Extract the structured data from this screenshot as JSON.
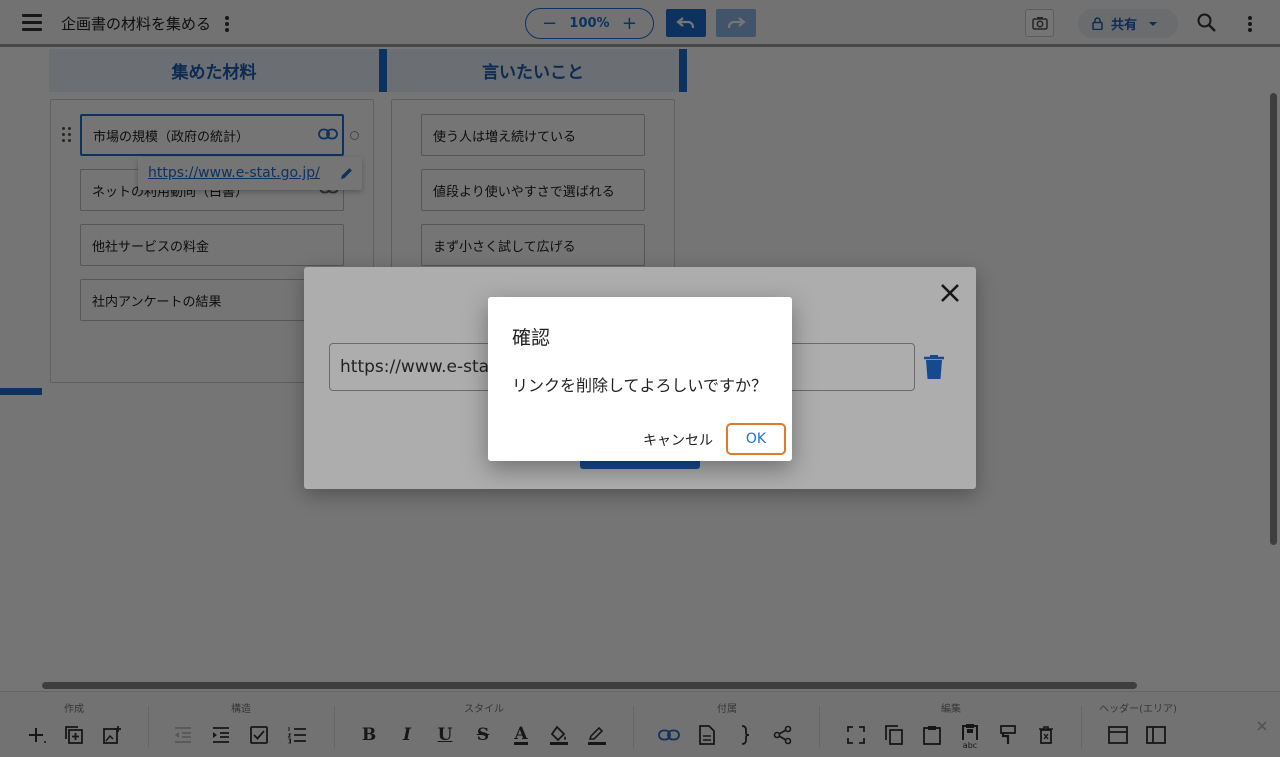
{
  "header": {
    "title": "企画書の材料を集める",
    "zoom_minus": "−",
    "zoom_value": "100%",
    "zoom_plus": "+",
    "share_label": "共有"
  },
  "areas": [
    {
      "title": "集めた材料",
      "cards": [
        "市場の規模（政府の統計）",
        "ネットの利用動向（白書）",
        "他社サービスの料金",
        "社内アンケートの結果"
      ]
    },
    {
      "title": "言いたいこと",
      "cards": [
        "使う人は増え続けている",
        "値段より使いやすさで選ばれる",
        "まず小さく試して広げる"
      ]
    }
  ],
  "link_popup": {
    "url": "https://www.e-stat.go.jp/"
  },
  "toolbar": {
    "groups": [
      "作成",
      "構造",
      "スタイル",
      "付属",
      "編集",
      "ヘッダー(エリア)"
    ],
    "letters": {
      "bold": "B",
      "italic": "I",
      "underline": "U",
      "strike": "S",
      "color": "A",
      "abc": "abc"
    }
  },
  "link_dialog": {
    "url_value": "https://www.e-stat.go.jp/"
  },
  "confirm_dialog": {
    "title": "確認",
    "message": "リンクを削除してよろしいですか？",
    "cancel_label": "キャンセル",
    "ok_label": "OK"
  },
  "colors": {
    "accent": "#1f6fd1",
    "focus_ring": "#e07a2a"
  }
}
